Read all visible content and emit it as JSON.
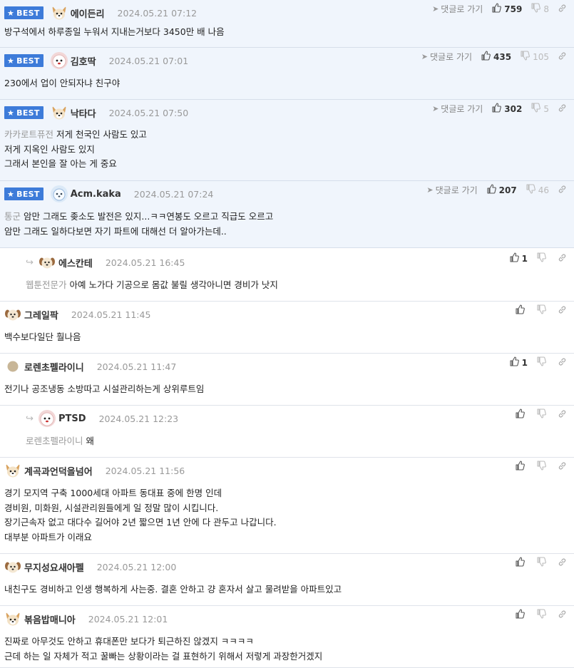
{
  "colors": {
    "accent": "#3d7bd9",
    "best_bg": "#f0f5fc",
    "muted": "#999999"
  },
  "labels": {
    "best": "BEST",
    "goto": "댓글로 가기"
  },
  "comments": [
    {
      "best": true,
      "reply": false,
      "avatar": "dog-icon",
      "nick": "에이든리",
      "date": "2024.05.21 07:12",
      "goto": true,
      "likes": "759",
      "dislikes": "8",
      "mention": "",
      "lines": [
        "방구석에서 하루종일 누워서 지내는거보다 3450만 배 나음"
      ]
    },
    {
      "best": true,
      "reply": false,
      "avatar": "fluffy-dog-icon",
      "nick": "김호딱",
      "date": "2024.05.21 07:01",
      "goto": true,
      "likes": "435",
      "dislikes": "105",
      "mention": "",
      "lines": [
        "230에서 업이 안되자냐 친구야"
      ]
    },
    {
      "best": true,
      "reply": false,
      "avatar": "dog-icon",
      "nick": "낙타다",
      "date": "2024.05.21 07:50",
      "goto": true,
      "likes": "302",
      "dislikes": "5",
      "mention": "카카로트퓨전",
      "lines": [
        "저게 천국인 사람도 있고",
        "저게 지옥인 사람도 있지",
        "그래서 본인을 잘 아는 게 중요"
      ]
    },
    {
      "best": true,
      "reply": false,
      "avatar": "blue-pup-icon",
      "nick": "Acm.kaka",
      "date": "2024.05.21 07:24",
      "goto": true,
      "likes": "207",
      "dislikes": "46",
      "mention": "통군",
      "lines": [
        "암만 그래도 좆소도 발전은 있지...ㅋㅋ연봉도 오르고 직급도 오르고",
        "암만 그래도 일하다보면 자기 파트에 대해선 더 알아가는데.."
      ]
    },
    {
      "best": false,
      "reply": true,
      "avatar": "puppy-icon",
      "nick": "에스칸테",
      "date": "2024.05.21 16:45",
      "goto": false,
      "likes": "1",
      "dislikes": "",
      "mention": "웹툰전문가",
      "lines": [
        "아예 노가다 기공으로 몸값 불릴 생각아니면 경비가 낫지"
      ]
    },
    {
      "best": false,
      "reply": false,
      "avatar": "puppy-icon",
      "nick": "그레일팍",
      "date": "2024.05.21 11:45",
      "goto": false,
      "likes": "",
      "dislikes": "",
      "mention": "",
      "lines": [
        "백수보다일단 훨나음"
      ]
    },
    {
      "best": false,
      "reply": false,
      "avatar": "dot-icon",
      "nick": "로렌초펠라이니",
      "date": "2024.05.21 11:47",
      "goto": false,
      "likes": "1",
      "dislikes": "",
      "mention": "",
      "lines": [
        "전기나 공조냉동 소방따고 시설관리하는게 상위루트임"
      ]
    },
    {
      "best": false,
      "reply": true,
      "avatar": "fluffy-dog-icon",
      "nick": "PTSD",
      "date": "2024.05.21 12:23",
      "goto": false,
      "likes": "",
      "dislikes": "",
      "mention": "로렌초펠라이니",
      "lines": [
        "왜"
      ]
    },
    {
      "best": false,
      "reply": false,
      "avatar": "dog-icon",
      "nick": "계곡과언덕을넘어",
      "date": "2024.05.21 11:56",
      "goto": false,
      "likes": "",
      "dislikes": "",
      "mention": "",
      "lines": [
        "경기 모지역 구축 1000세대 아파트 동대표 중에 한명 인데",
        "경비원, 미화원, 시설관리원들에게 일 정말 많이 시킵니다.",
        "장기근속자 없고 대다수 길어야 2년 짧으면 1년 안에 다 관두고 나갑니다.",
        "대부분 아파트가 이래요"
      ]
    },
    {
      "best": false,
      "reply": false,
      "avatar": "puppy-icon",
      "nick": "무지성요새아펠",
      "date": "2024.05.21 12:00",
      "goto": false,
      "likes": "",
      "dislikes": "",
      "mention": "",
      "lines": [
        "내친구도 경비하고 인생 행복하게 사는중. 결혼 안하고 걍 혼자서 살고 물려받을 아파트있고"
      ]
    },
    {
      "best": false,
      "reply": false,
      "avatar": "dog-icon",
      "nick": "볶음밥매니아",
      "date": "2024.05.21 12:01",
      "goto": false,
      "likes": "",
      "dislikes": "",
      "mention": "",
      "lines": [
        "진짜로 아무것도 안하고 휴대폰만 보다가 퇴근하진 않겠지 ㅋㅋㅋㅋ",
        "근데 하는 일 자체가 적고 꿀빠는 상황이라는 걸 표현하기 위해서 저렇게 과장한거겠지"
      ]
    }
  ]
}
